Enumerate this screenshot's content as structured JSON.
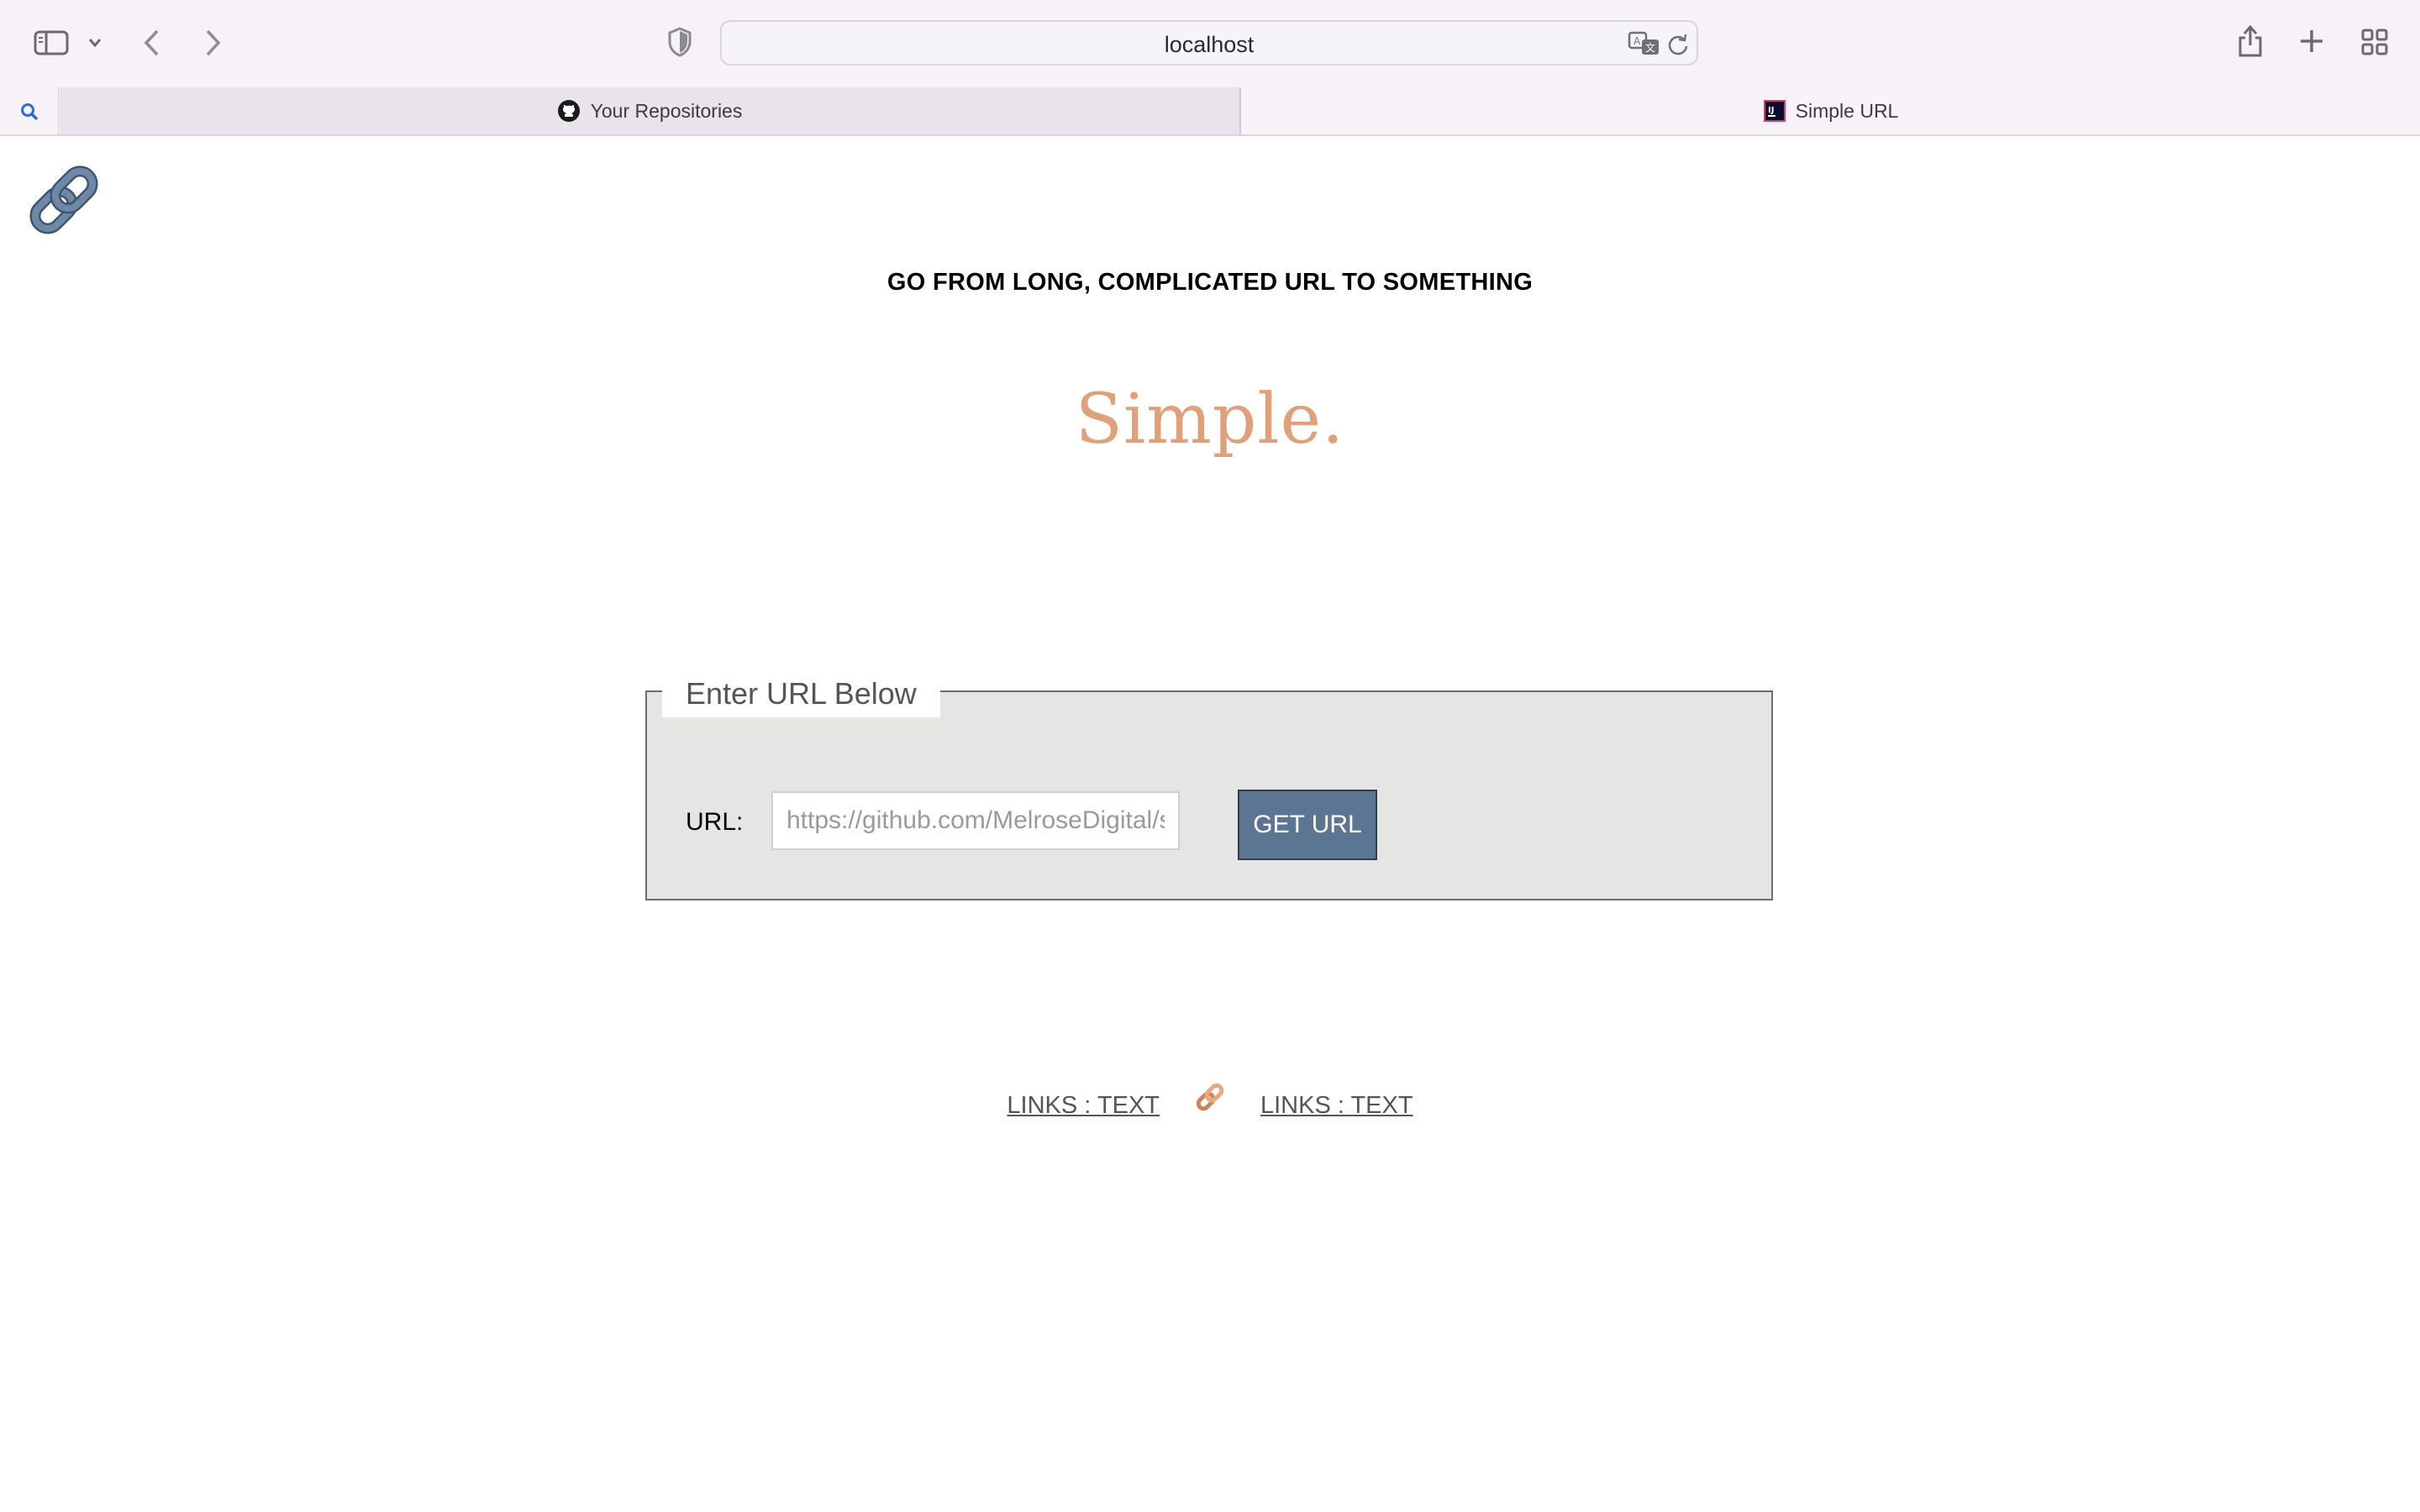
{
  "browser": {
    "address": "localhost",
    "tabs": [
      {
        "label": "Your Repositories",
        "favicon": "github-icon"
      },
      {
        "label": "Simple URL",
        "favicon": "intellij-icon"
      }
    ]
  },
  "page": {
    "tagline": "GO FROM LONG, COMPLICATED URL TO SOMETHING",
    "brand": "Simple.",
    "form": {
      "legend": "Enter URL Below",
      "url_label": "URL:",
      "url_placeholder": "https://github.com/MelroseDigital/s",
      "url_value": "",
      "submit_label": "GET URL"
    },
    "footer": {
      "link_left": "LINKS : TEXT",
      "link_right": "LINKS : TEXT"
    }
  },
  "colors": {
    "brand": "#e0a07c",
    "button": "#5c7593",
    "form_background": "#e5e5e3",
    "chain_icon": "#5d7691"
  }
}
